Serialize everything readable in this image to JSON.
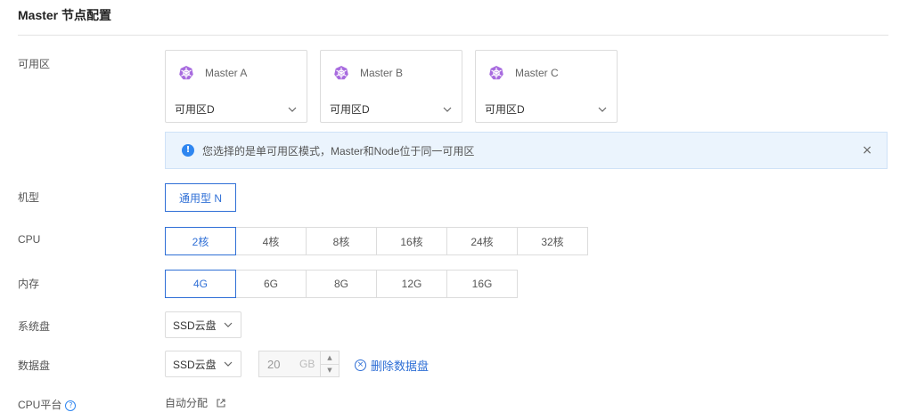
{
  "section": {
    "title": "Master 节点配置"
  },
  "labels": {
    "zone": "可用区",
    "machine_type": "机型",
    "cpu": "CPU",
    "memory": "内存",
    "system_disk": "系统盘",
    "data_disk": "数据盘",
    "cpu_platform": "CPU平台"
  },
  "masters": [
    {
      "name": "Master A",
      "zone": "可用区D"
    },
    {
      "name": "Master B",
      "zone": "可用区D"
    },
    {
      "name": "Master C",
      "zone": "可用区D"
    }
  ],
  "alert": {
    "text": "您选择的是单可用区模式，Master和Node位于同一可用区",
    "close": "×"
  },
  "machine_type": {
    "selected": "通用型 N"
  },
  "cpu_options": [
    "2核",
    "4核",
    "8核",
    "16核",
    "24核",
    "32核"
  ],
  "cpu_selected": "2核",
  "memory_options": [
    "4G",
    "6G",
    "8G",
    "12G",
    "16G"
  ],
  "memory_selected": "4G",
  "system_disk": {
    "type": "SSD云盘"
  },
  "data_disk": {
    "type": "SSD云盘",
    "size": "20",
    "unit": "GB",
    "delete_label": "删除数据盘"
  },
  "cpu_platform": {
    "value": "自动分配"
  },
  "colors": {
    "accent": "#2f6fd6",
    "info": "#2f86f0",
    "alert_bg": "#ebf4fd",
    "k8s_icon": "#a86bdf"
  },
  "icons": {
    "master": "kubernetes-wheel-icon",
    "dropdown": "chevron-down-icon",
    "info": "info-icon",
    "close": "close-icon",
    "help": "question-circle-icon",
    "external": "external-link-icon",
    "delete": "x-circle-icon"
  }
}
